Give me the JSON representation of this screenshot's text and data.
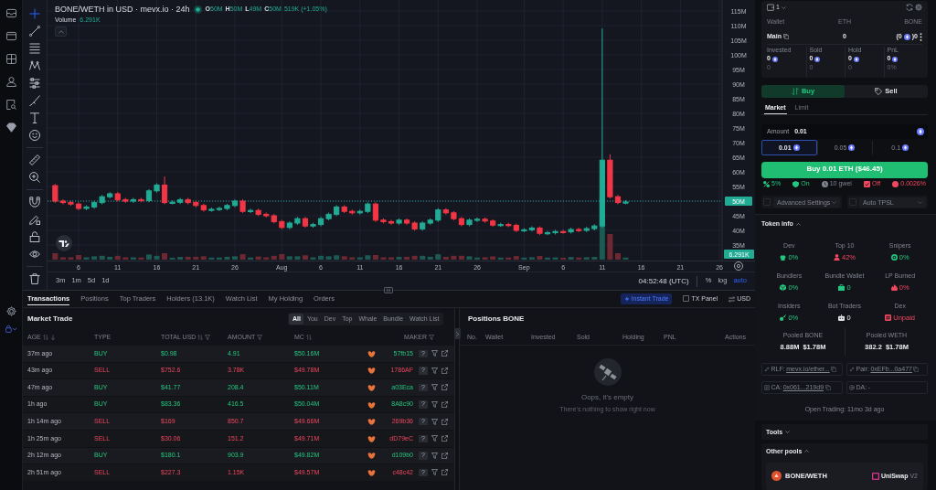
{
  "chart": {
    "title": "BONE/WETH in USD · mevx.io · 24h",
    "ohlc": [
      {
        "key": "O",
        "value": "50M"
      },
      {
        "key": "H",
        "value": "50M"
      },
      {
        "key": "L",
        "value": "49M"
      },
      {
        "key": "C",
        "value": "50M"
      }
    ],
    "change": "519K (+1.05%)",
    "volume_label": "Volume",
    "volume_value": "6.291K",
    "price_ticks": [
      {
        "label": "115M",
        "highlighted": false
      },
      {
        "label": "110M",
        "highlighted": false
      },
      {
        "label": "105M",
        "highlighted": false
      },
      {
        "label": "100M",
        "highlighted": false
      },
      {
        "label": "95M",
        "highlighted": false
      },
      {
        "label": "90M",
        "highlighted": false
      },
      {
        "label": "85M",
        "highlighted": false
      },
      {
        "label": "80M",
        "highlighted": false
      },
      {
        "label": "75M",
        "highlighted": false
      },
      {
        "label": "70M",
        "highlighted": false
      },
      {
        "label": "65M",
        "highlighted": false
      },
      {
        "label": "60M",
        "highlighted": false
      },
      {
        "label": "55M",
        "highlighted": false
      },
      {
        "label": "50M",
        "highlighted": true
      },
      {
        "label": "45M",
        "highlighted": false
      },
      {
        "label": "40M",
        "highlighted": false
      },
      {
        "label": "35M",
        "highlighted": false
      }
    ],
    "volume_tag": "6.291K",
    "date_ticks": [
      "6",
      "11",
      "16",
      "21",
      "26",
      "Aug",
      "6",
      "11",
      "16",
      "21",
      "26",
      "Sep",
      "6",
      "11",
      "16",
      "21",
      "26"
    ],
    "ranges": [
      "3m",
      "1m",
      "5d",
      "1d"
    ],
    "clock": "04:52:48 (UTC)",
    "scale_options": [
      {
        "label": "%",
        "selected": false
      },
      {
        "label": "log",
        "selected": false
      },
      {
        "label": "auto",
        "selected": true
      }
    ]
  },
  "bottom_tabs": [
    {
      "label": "Transactions",
      "selected": true
    },
    {
      "label": "Positions",
      "selected": false
    },
    {
      "label": "Top Traders",
      "selected": false
    },
    {
      "label": "Holders (13.1K)",
      "selected": false
    },
    {
      "label": "Watch List",
      "selected": false
    },
    {
      "label": "My Holding",
      "selected": false
    },
    {
      "label": "Orders",
      "selected": false
    }
  ],
  "instant_trade": "Instant Trade",
  "tx_panel": {
    "label": "TX Panel",
    "checked": false
  },
  "currency": "USD",
  "market_trade": {
    "title": "Market Trade",
    "filters": [
      {
        "label": "All",
        "selected": true
      },
      {
        "label": "You",
        "selected": false
      },
      {
        "label": "Dev",
        "selected": false
      },
      {
        "label": "Top",
        "selected": false
      },
      {
        "label": "Whale",
        "selected": false
      },
      {
        "label": "Bundle",
        "selected": false
      },
      {
        "label": "Watch List",
        "selected": false
      }
    ],
    "columns": [
      {
        "label": "AGE",
        "sort": true,
        "sorted": true,
        "filter": false
      },
      {
        "label": "TYPE",
        "sort": false,
        "sorted": false,
        "filter": false
      },
      {
        "label": "TOTAL USD",
        "sort": true,
        "sorted": false,
        "filter": true
      },
      {
        "label": "AMOUNT",
        "sort": false,
        "sorted": false,
        "filter": true
      },
      {
        "label": "MC",
        "sort": true,
        "sorted": false,
        "filter": false
      },
      {
        "label": "MAKER",
        "sort": false,
        "sorted": false,
        "filter": true
      }
    ],
    "rows": [
      {
        "age": "37m ago",
        "type": "BUY",
        "kind": "buy",
        "total": "$0.98",
        "amount": "4.91",
        "mc": "$50.16M",
        "maker": "57fb15",
        "badge": "?"
      },
      {
        "age": "43m ago",
        "type": "SELL",
        "kind": "sell",
        "total": "$752.6",
        "amount": "3.78K",
        "mc": "$49.78M",
        "maker": "1786AF",
        "badge": "?"
      },
      {
        "age": "47m ago",
        "type": "BUY",
        "kind": "buy",
        "total": "$41.77",
        "amount": "208.4",
        "mc": "$50.11M",
        "maker": "a03Eca",
        "badge": "?"
      },
      {
        "age": "1h ago",
        "type": "BUY",
        "kind": "buy",
        "total": "$83.36",
        "amount": "416.5",
        "mc": "$50.04M",
        "maker": "8A8c90",
        "badge": "?"
      },
      {
        "age": "1h 14m ago",
        "type": "SELL",
        "kind": "sell",
        "total": "$169",
        "amount": "850.7",
        "mc": "$49.66M",
        "maker": "269b36",
        "badge": "?"
      },
      {
        "age": "1h 25m ago",
        "type": "SELL",
        "kind": "sell",
        "total": "$30.06",
        "amount": "151.2",
        "mc": "$49.71M",
        "maker": "dD79eC",
        "badge": "?"
      },
      {
        "age": "2h 12m ago",
        "type": "BUY",
        "kind": "buy",
        "total": "$180.1",
        "amount": "903.9",
        "mc": "$49.82M",
        "maker": "d109b0",
        "badge": "?"
      },
      {
        "age": "2h 51m ago",
        "type": "SELL",
        "kind": "sell",
        "total": "$227.3",
        "amount": "1.15K",
        "mc": "$49.57M",
        "maker": "c48c42",
        "badge": "?"
      }
    ]
  },
  "positions": {
    "title": "Positions BONE",
    "columns": [
      "No.",
      "Wallet",
      "Invested",
      "Sold",
      "Holding",
      "PNL",
      "Actions"
    ],
    "empty_title": "Oops, it's empty",
    "empty_text": "There's nothing to show right now"
  },
  "trade_panel": {
    "wallet_count": "1",
    "wallet_columns": [
      "Wallet",
      "ETH",
      "BONE"
    ],
    "wallet": {
      "name": "Main",
      "eth": "0",
      "bone_before_icon": "(0",
      "bone_after_icon": ")0"
    },
    "stats": [
      {
        "label": "Invested",
        "value": "0",
        "sub": "0"
      },
      {
        "label": "Sold",
        "value": "0",
        "sub": "0"
      },
      {
        "label": "Hold",
        "value": "0",
        "sub": "0"
      },
      {
        "label": "PnL",
        "value": "0",
        "sub": "0%"
      }
    ],
    "sides": [
      {
        "label": "Buy",
        "kind": "buy",
        "selected": true
      },
      {
        "label": "Sell",
        "kind": "sell",
        "selected": false
      }
    ],
    "order_types": [
      {
        "label": "Market",
        "selected": true
      },
      {
        "label": "Limit",
        "selected": false
      }
    ],
    "amount": {
      "label": "Amount",
      "value": "0.01"
    },
    "presets": [
      {
        "label": "0.01",
        "selected": true
      },
      {
        "label": "0.05",
        "selected": false
      },
      {
        "label": "0.1",
        "selected": false
      }
    ],
    "submit": "Buy 0.01 ETH ($46.45)",
    "settings": [
      {
        "kind": "slippage",
        "value": "5%",
        "color": "#22c77f"
      },
      {
        "kind": "protection",
        "value": "On",
        "color": "#22c77f"
      },
      {
        "kind": "gas",
        "value": "10 gwei",
        "color": "#80848f"
      },
      {
        "kind": "bribe",
        "value": "Off",
        "color": "#f0465e"
      },
      {
        "kind": "fee",
        "value": "0.0026%",
        "color": "#f0465e"
      }
    ],
    "options": [
      {
        "label": "Advanced Settings",
        "checked": false
      },
      {
        "label": "Auto TPSL",
        "checked": false
      }
    ]
  },
  "token_info": {
    "title": "Token info",
    "expanded": true,
    "metrics": [
      {
        "kind": "dev",
        "label": "Dev",
        "value": "0%",
        "color": "#22c77f"
      },
      {
        "kind": "top10",
        "label": "Top 10",
        "value": "42%",
        "color": "#f0465e"
      },
      {
        "kind": "snipers",
        "label": "Snipers",
        "value": "0%",
        "color": "#22c77f"
      },
      {
        "kind": "bundlers",
        "label": "Bundlers",
        "value": "0%",
        "color": "#22c77f"
      },
      {
        "kind": "bundle_wallet",
        "label": "Bundle Wallet",
        "value": "0",
        "color": "#22c77f"
      },
      {
        "kind": "lp_burned",
        "label": "LP Burned",
        "value": "0%",
        "color": "#f0465e"
      },
      {
        "kind": "insiders",
        "label": "Insiders",
        "value": "0%",
        "color": "#22c77f"
      },
      {
        "kind": "bot_traders",
        "label": "Bot Traders",
        "value": "0",
        "color": "#e6e7ea"
      },
      {
        "kind": "dex",
        "label": "Dex",
        "value": "Unpaid",
        "color": "#f0465e"
      }
    ],
    "pools": [
      {
        "label": "Pooled BONE",
        "amount": "8.88M",
        "usd": "$1.78M"
      },
      {
        "label": "Pooled WETH",
        "amount": "382.2",
        "usd": "$1.78M"
      }
    ],
    "links": [
      {
        "kind": "link",
        "label": "RLF:",
        "value": "mevx.io/ether...",
        "linked": true,
        "copy": true
      },
      {
        "kind": "link",
        "label": "Pair:",
        "value": "0xEFb...0a477",
        "linked": true,
        "copy": true
      },
      {
        "kind": "document",
        "label": "CA:",
        "value": "0x061...219d9",
        "linked": true,
        "copy": true
      },
      {
        "kind": "at",
        "label": "DA:",
        "value": "-",
        "linked": false,
        "copy": false
      }
    ],
    "open_trading": "Open Trading: 11mo 3d ago"
  },
  "tools": {
    "title": "Tools",
    "expanded": false
  },
  "other_pools": {
    "title": "Other pools",
    "expanded": true,
    "pools": [
      {
        "pair": "BONE/WETH",
        "dex": "UniSwap",
        "version": "V2"
      }
    ]
  }
}
